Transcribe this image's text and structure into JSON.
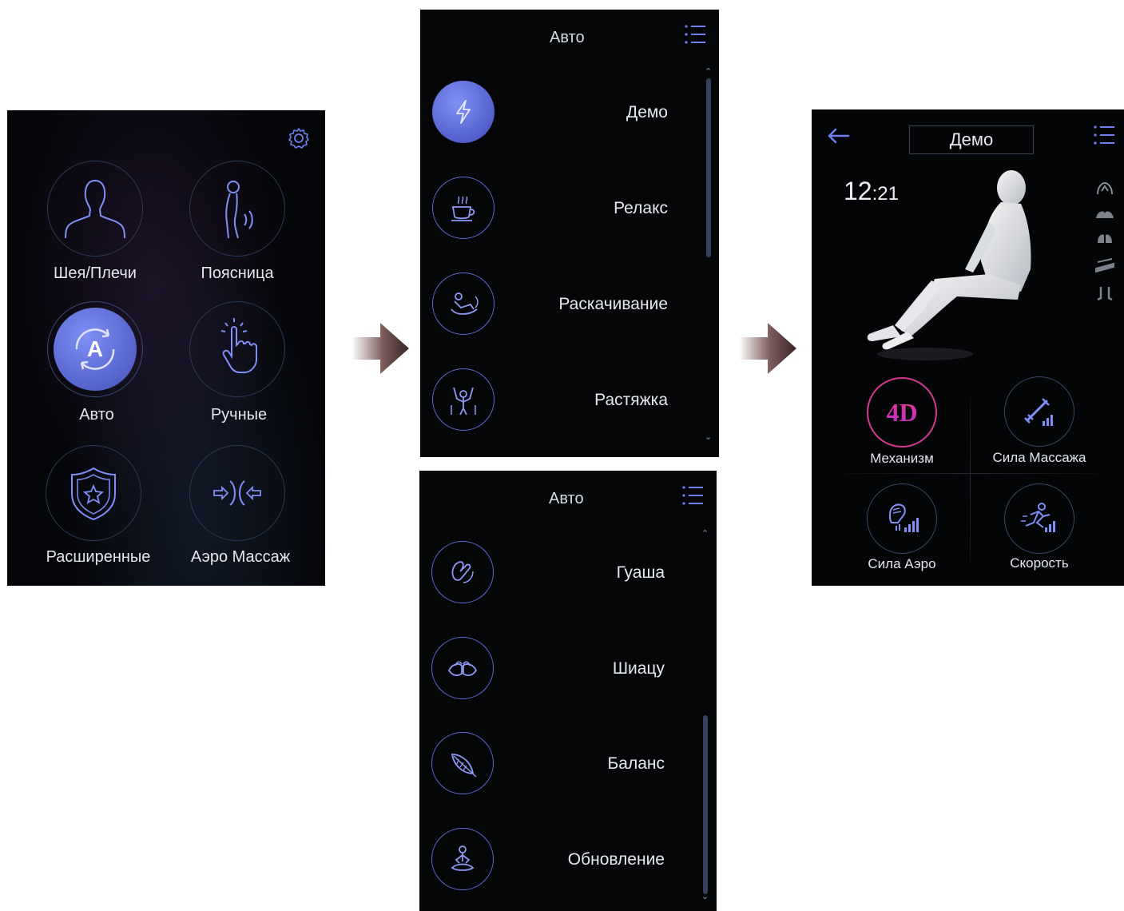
{
  "home": {
    "tiles": [
      {
        "label": "Шея/Плечи",
        "icon": "neck-shoulders-icon"
      },
      {
        "label": "Поясница",
        "icon": "lower-back-icon"
      },
      {
        "label": "Авто",
        "icon": "auto-icon",
        "badge": "A"
      },
      {
        "label": "Ручные",
        "icon": "manual-hand-icon"
      },
      {
        "label": "Расширенные",
        "icon": "shield-star-icon"
      },
      {
        "label": "Аэро Массаж",
        "icon": "air-massage-icon"
      }
    ],
    "settings_icon": "gear-icon"
  },
  "auto_list_1": {
    "title": "Авто",
    "items": [
      {
        "label": "Демо",
        "icon": "lightning-icon",
        "selected": true
      },
      {
        "label": "Релакс",
        "icon": "coffee-cup-icon"
      },
      {
        "label": "Раскачивание",
        "icon": "rocking-icon"
      },
      {
        "label": "Растяжка",
        "icon": "stretch-icon"
      }
    ]
  },
  "auto_list_2": {
    "title": "Авто",
    "items": [
      {
        "label": "Гуаша",
        "icon": "guasha-hands-icon"
      },
      {
        "label": "Шиацу",
        "icon": "shiatsu-hands-icon"
      },
      {
        "label": "Баланс",
        "icon": "feather-icon"
      },
      {
        "label": "Обновление",
        "icon": "meditation-icon"
      }
    ]
  },
  "demo_screen": {
    "title": "Демо",
    "timer_hours": "12",
    "timer_sep": ":",
    "timer_minutes": "21",
    "four_d_text": "4D",
    "controls": [
      {
        "label": "Механизм",
        "icon": "4d-mechanism-icon"
      },
      {
        "label": "Сила Массажа",
        "icon": "massage-strength-icon"
      },
      {
        "label": "Сила Аэро",
        "icon": "air-strength-icon"
      },
      {
        "label": "Скорость",
        "icon": "speed-icon"
      }
    ],
    "side_icons": [
      "neck-zone-icon",
      "shoulder-zone-icon",
      "hands-zone-icon",
      "seat-zone-icon",
      "feet-zone-icon"
    ]
  },
  "colors": {
    "accent": "#5e6ad8",
    "accent_fill": "#6b7ae6",
    "four_d": "#e03a8c",
    "panel_bg": "#050608",
    "arrow": "#6b4a4a"
  }
}
